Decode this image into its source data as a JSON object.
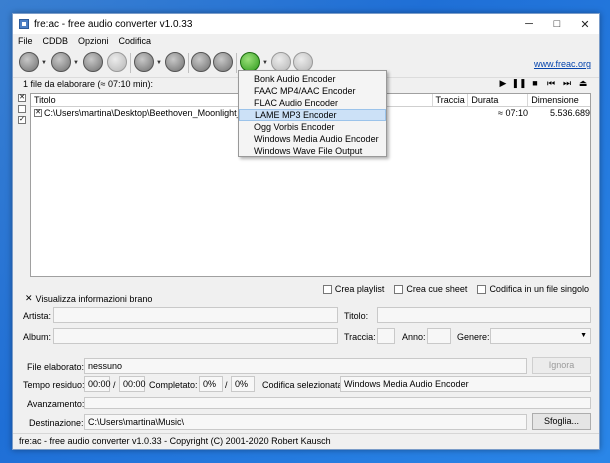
{
  "window": {
    "title": "fre:ac - free audio converter v1.0.33"
  },
  "window_controls": {
    "minimize": "─",
    "maximize": "□",
    "close": "✕"
  },
  "menu": [
    "File",
    "CDDB",
    "Opzioni",
    "Codifica"
  ],
  "toolbar": {
    "link": "www.freac.org"
  },
  "status": {
    "files_count": "1 file da elaborare (≈ 07:10 min):"
  },
  "player": {
    "play": "▶",
    "pause": "❚❚",
    "stop": "■",
    "prev": "⏮",
    "next": "⏭",
    "eject": "⏏"
  },
  "file_list": {
    "columns": [
      "Titolo",
      "Traccia",
      "Durata",
      "Dimensione"
    ],
    "rows": [
      {
        "title": "C:\\Users\\martina\\Desktop\\Beethoven_Moonlight_Sonata.wav",
        "track": "",
        "duration": "≈ 07:10",
        "size": "5.536.689"
      }
    ]
  },
  "encoder_menu": {
    "items": [
      "Bonk Audio Encoder",
      "FAAC MP4/AAC Encoder",
      "FLAC Audio Encoder",
      "LAME MP3 Encoder",
      "Ogg Vorbis Encoder",
      "Windows Media Audio Encoder",
      "Windows Wave File Output"
    ],
    "selected_index": 3
  },
  "options": {
    "playlist": "Crea playlist",
    "cue_sheet": "Crea cue sheet",
    "single_file": "Codifica in un file singolo"
  },
  "info": {
    "toggle_label": "Visualizza informazioni brano",
    "artist_label": "Artista:",
    "title_label": "Titolo:",
    "album_label": "Album:",
    "track_label": "Traccia:",
    "year_label": "Anno:",
    "genre_label": "Genere:"
  },
  "progress": {
    "file_label": "File elaborato:",
    "file_value": "nessuno",
    "skip_button": "Ignora",
    "remaining_label": "Tempo residuo:",
    "remaining_value": "00:00",
    "slash": "/",
    "total_value": "00:00",
    "completed_label": "Completato:",
    "completed_value": "0%",
    "completed_total": "0%",
    "encoder_label": "Codifica selezionata:",
    "encoder_value": "Windows Media Audio Encoder",
    "advancement_label": "Avanzamento:",
    "destination_label": "Destinazione:",
    "destination_value": "C:\\Users\\martina\\Music\\",
    "browse_button": "Sfoglia..."
  },
  "statusbar": "fre:ac - free audio converter v1.0.33 - Copyright (C) 2001-2020 Robert Kausch"
}
